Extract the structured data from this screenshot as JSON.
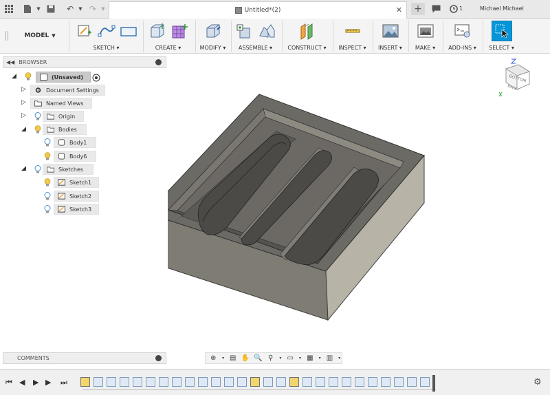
{
  "titlebar": {
    "grid_icon": "app-grid-icon",
    "file_icon": "file-icon",
    "save_icon": "save-icon",
    "undo_icon": "undo-icon",
    "redo_icon": "redo-icon",
    "document_title": "Untitled*(2)",
    "job_count": "1",
    "user_name": "Michael Michael"
  },
  "toolbar": {
    "workspace": "MODEL",
    "groups": [
      {
        "label": "SKETCH"
      },
      {
        "label": "CREATE"
      },
      {
        "label": "MODIFY"
      },
      {
        "label": "ASSEMBLE"
      },
      {
        "label": "CONSTRUCT"
      },
      {
        "label": "INSPECT"
      },
      {
        "label": "INSERT"
      },
      {
        "label": "MAKE"
      },
      {
        "label": "ADD-INS"
      },
      {
        "label": "SELECT"
      }
    ]
  },
  "browser": {
    "title": "BROWSER",
    "root_label": "(Unsaved)",
    "items": [
      {
        "label": "Document Settings"
      },
      {
        "label": "Named Views"
      },
      {
        "label": "Origin"
      },
      {
        "label": "Bodies"
      },
      {
        "label": "Body1"
      },
      {
        "label": "Body6"
      },
      {
        "label": "Sketches"
      },
      {
        "label": "Sketch1"
      },
      {
        "label": "Sketch2"
      },
      {
        "label": "Sketch3"
      }
    ]
  },
  "comments": {
    "title": "COMMENTS"
  },
  "viewcube": {
    "faces": [
      "BOTTOM",
      "BACK"
    ]
  },
  "colors": {
    "accent": "#0696d7",
    "body": "#7d7b74",
    "bulb_on": "#f2c94c",
    "bulb_off": "#7fb3e0"
  }
}
